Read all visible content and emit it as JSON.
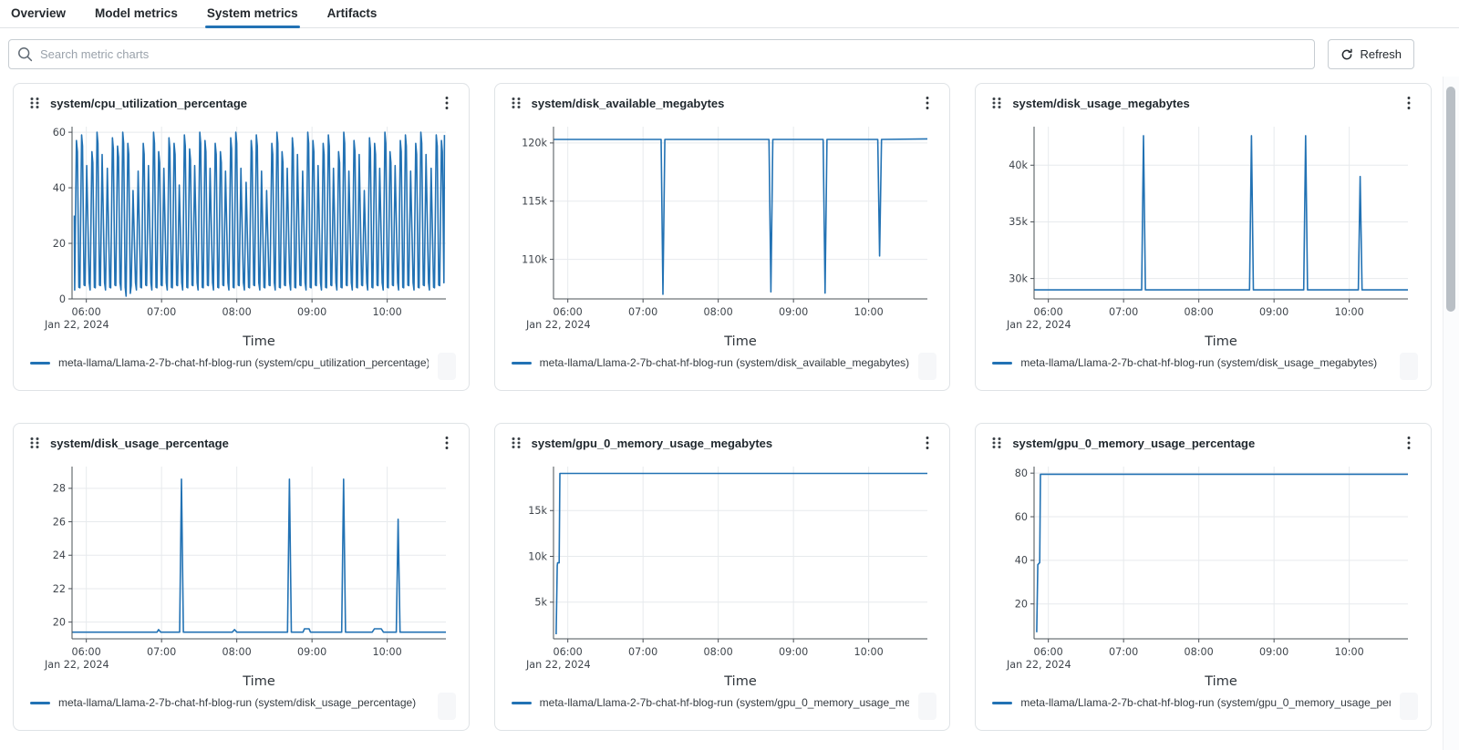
{
  "tabs": [
    {
      "label": "Overview",
      "active": false
    },
    {
      "label": "Model metrics",
      "active": false
    },
    {
      "label": "System metrics",
      "active": true
    },
    {
      "label": "Artifacts",
      "active": false
    }
  ],
  "toolbar": {
    "search_placeholder": "Search metric charts",
    "refresh_label": "Refresh"
  },
  "colors": {
    "accent": "#2272b4",
    "line": "#2272b4",
    "grid": "#e7eaed",
    "spine": "#4a5056",
    "tick_text": "#40464d"
  },
  "x_axis": {
    "title": "Time",
    "date_label": "Jan 22, 2024",
    "range": [
      5.81,
      10.78
    ],
    "ticks": [
      {
        "t": 6,
        "label": "06:00"
      },
      {
        "t": 7,
        "label": "07:00"
      },
      {
        "t": 8,
        "label": "08:00"
      },
      {
        "t": 9,
        "label": "09:00"
      },
      {
        "t": 10,
        "label": "10:00"
      }
    ]
  },
  "chart_data": [
    {
      "type": "line",
      "title": "system/cpu_utilization_percentage",
      "legend": "meta-llama/Llama-2-7b-chat-hf-blog-run (system/cpu_utilization_percentage)",
      "xlabel": "Time",
      "ylim": [
        0,
        62
      ],
      "y_ticks": [
        {
          "v": 0,
          "label": "0"
        },
        {
          "v": 20,
          "label": "20"
        },
        {
          "v": 40,
          "label": "40"
        },
        {
          "v": 60,
          "label": "60"
        }
      ],
      "wave": {
        "t_start": 5.84,
        "t_end": 10.76,
        "low": 3.2,
        "dip_index": 10,
        "dip_value": 1.0,
        "peaks": [
          57,
          59,
          48,
          53,
          60,
          52,
          47,
          58,
          55,
          60,
          56,
          39,
          46,
          56,
          48,
          60,
          53,
          47,
          58,
          56,
          41,
          59,
          54,
          48,
          60,
          57,
          47,
          56,
          53,
          46,
          58,
          60,
          47,
          42,
          57,
          59,
          46,
          39,
          56,
          60,
          53,
          47,
          58,
          52,
          46,
          60,
          57,
          48,
          56,
          59,
          47,
          53,
          60,
          46,
          57,
          52,
          39,
          58,
          56,
          47,
          60,
          53,
          48,
          57,
          59,
          46,
          56,
          60,
          52,
          47,
          59,
          57
        ]
      }
    },
    {
      "type": "line",
      "title": "system/disk_available_megabytes",
      "legend": "meta-llama/Llama-2-7b-chat-hf-blog-run (system/disk_available_megabytes)",
      "xlabel": "Time",
      "ylim": [
        106600,
        121400
      ],
      "y_ticks": [
        {
          "v": 110000,
          "label": "110k"
        },
        {
          "v": 115000,
          "label": "115k"
        },
        {
          "v": 120000,
          "label": "120k"
        }
      ],
      "points": [
        [
          5.81,
          120300
        ],
        [
          7.24,
          120300
        ],
        [
          7.265,
          107000
        ],
        [
          7.29,
          120300
        ],
        [
          8.675,
          120300
        ],
        [
          8.7,
          107200
        ],
        [
          8.725,
          120300
        ],
        [
          9.395,
          120300
        ],
        [
          9.42,
          107100
        ],
        [
          9.445,
          120300
        ],
        [
          10.12,
          120300
        ],
        [
          10.145,
          110300
        ],
        [
          10.17,
          120300
        ],
        [
          10.78,
          120350
        ]
      ]
    },
    {
      "type": "line",
      "title": "system/disk_usage_megabytes",
      "legend": "meta-llama/Llama-2-7b-chat-hf-blog-run (system/disk_usage_megabytes)",
      "xlabel": "Time",
      "ylim": [
        28200,
        43400
      ],
      "y_ticks": [
        {
          "v": 30000,
          "label": "30k"
        },
        {
          "v": 35000,
          "label": "35k"
        },
        {
          "v": 40000,
          "label": "40k"
        }
      ],
      "points": [
        [
          5.81,
          29000
        ],
        [
          7.24,
          29000
        ],
        [
          7.265,
          42600
        ],
        [
          7.29,
          29000
        ],
        [
          8.675,
          29000
        ],
        [
          8.7,
          42600
        ],
        [
          8.725,
          29000
        ],
        [
          9.395,
          29000
        ],
        [
          9.42,
          42600
        ],
        [
          9.445,
          29000
        ],
        [
          10.12,
          29000
        ],
        [
          10.145,
          39000
        ],
        [
          10.17,
          29000
        ],
        [
          10.78,
          29000
        ]
      ]
    },
    {
      "type": "line",
      "title": "system/disk_usage_percentage",
      "legend": "meta-llama/Llama-2-7b-chat-hf-blog-run (system/disk_usage_percentage)",
      "xlabel": "Time",
      "ylim": [
        19.0,
        29.3
      ],
      "y_ticks": [
        {
          "v": 20,
          "label": "20"
        },
        {
          "v": 22,
          "label": "22"
        },
        {
          "v": 24,
          "label": "24"
        },
        {
          "v": 26,
          "label": "26"
        },
        {
          "v": 28,
          "label": "28"
        }
      ],
      "points": [
        [
          5.81,
          19.4
        ],
        [
          6.94,
          19.4
        ],
        [
          6.96,
          19.55
        ],
        [
          6.99,
          19.4
        ],
        [
          7.24,
          19.4
        ],
        [
          7.265,
          28.55
        ],
        [
          7.29,
          19.4
        ],
        [
          7.94,
          19.4
        ],
        [
          7.97,
          19.55
        ],
        [
          8.0,
          19.4
        ],
        [
          8.675,
          19.4
        ],
        [
          8.7,
          28.55
        ],
        [
          8.725,
          19.4
        ],
        [
          8.88,
          19.4
        ],
        [
          8.9,
          19.6
        ],
        [
          8.96,
          19.6
        ],
        [
          8.98,
          19.4
        ],
        [
          9.395,
          19.4
        ],
        [
          9.42,
          28.55
        ],
        [
          9.445,
          19.4
        ],
        [
          9.8,
          19.4
        ],
        [
          9.83,
          19.6
        ],
        [
          9.92,
          19.6
        ],
        [
          9.95,
          19.4
        ],
        [
          10.12,
          19.4
        ],
        [
          10.145,
          26.15
        ],
        [
          10.17,
          19.4
        ],
        [
          10.78,
          19.4
        ]
      ]
    },
    {
      "type": "line",
      "title": "system/gpu_0_memory_usage_megabytes",
      "legend": "meta-llama/Llama-2-7b-chat-hf-blog-run (system/gpu_0_memory_usage_me...",
      "xlabel": "Time",
      "ylim": [
        1000,
        19800
      ],
      "y_ticks": [
        {
          "v": 5000,
          "label": "5k"
        },
        {
          "v": 10000,
          "label": "10k"
        },
        {
          "v": 15000,
          "label": "15k"
        }
      ],
      "points": [
        [
          5.845,
          1500
        ],
        [
          5.86,
          9000
        ],
        [
          5.865,
          9300
        ],
        [
          5.885,
          9300
        ],
        [
          5.895,
          19050
        ],
        [
          10.78,
          19050
        ]
      ]
    },
    {
      "type": "line",
      "title": "system/gpu_0_memory_usage_percentage",
      "legend": "meta-llama/Llama-2-7b-chat-hf-blog-run (system/gpu_0_memory_usage_per...",
      "xlabel": "Time",
      "ylim": [
        4,
        83
      ],
      "y_ticks": [
        {
          "v": 20,
          "label": "20"
        },
        {
          "v": 40,
          "label": "40"
        },
        {
          "v": 60,
          "label": "60"
        },
        {
          "v": 80,
          "label": "80"
        }
      ],
      "points": [
        [
          5.845,
          7
        ],
        [
          5.86,
          38
        ],
        [
          5.885,
          39
        ],
        [
          5.895,
          79.5
        ],
        [
          10.78,
          79.5
        ]
      ]
    }
  ]
}
